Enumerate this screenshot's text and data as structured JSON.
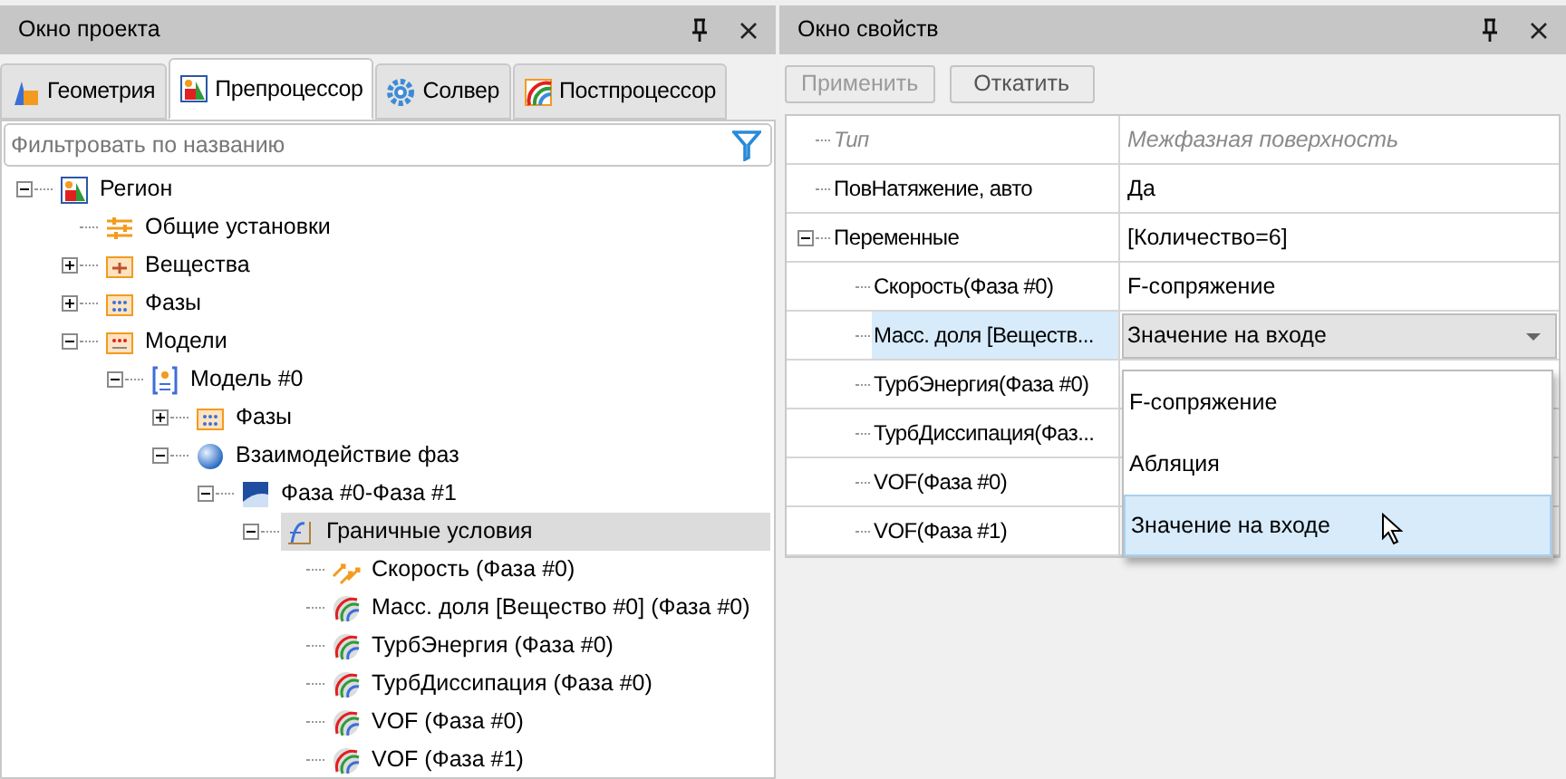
{
  "project_panel": {
    "title": "Окно проекта",
    "tabs": [
      {
        "label": "Геометрия",
        "kind": "geometry",
        "selected": false
      },
      {
        "label": "Препроцессор",
        "kind": "region",
        "selected": true
      },
      {
        "label": "Солвер",
        "kind": "gear",
        "selected": false
      },
      {
        "label": "Постпроцессор",
        "kind": "rainbow",
        "selected": false
      }
    ],
    "filter": {
      "placeholder": "Фильтровать по названию"
    },
    "tree": [
      {
        "label": "Регион",
        "kind": "region",
        "expanded": true,
        "selected": false,
        "children": [
          {
            "label": "Общие установки",
            "kind": "sliders",
            "selected": false
          },
          {
            "label": "Вещества",
            "kind": "substances",
            "expanded": false,
            "selected": false
          },
          {
            "label": "Фазы",
            "kind": "phases",
            "expanded": false,
            "selected": false
          },
          {
            "label": "Модели",
            "kind": "models",
            "expanded": true,
            "selected": false,
            "children": [
              {
                "label": "Модель #0",
                "kind": "model",
                "expanded": true,
                "selected": false,
                "children": [
                  {
                    "label": "Фазы",
                    "kind": "phases",
                    "expanded": false,
                    "selected": false
                  },
                  {
                    "label": "Взаимодействие фаз",
                    "kind": "sphere",
                    "expanded": true,
                    "selected": false,
                    "children": [
                      {
                        "label": "Фаза #0-Фаза #1",
                        "kind": "interface",
                        "expanded": true,
                        "selected": false,
                        "children": [
                          {
                            "label": "Граничные условия",
                            "kind": "bc",
                            "expanded": true,
                            "selected": true,
                            "children": [
                              {
                                "label": "Скорость (Фаза #0)",
                                "kind": "velocity",
                                "selected": false
                              },
                              {
                                "label": "Масс. доля [Вещество #0] (Фаза #0)",
                                "kind": "field",
                                "selected": false
                              },
                              {
                                "label": "ТурбЭнергия (Фаза #0)",
                                "kind": "field",
                                "selected": false
                              },
                              {
                                "label": "ТурбДиссипация (Фаза #0)",
                                "kind": "field",
                                "selected": false
                              },
                              {
                                "label": "VOF (Фаза #0)",
                                "kind": "field",
                                "selected": false
                              },
                              {
                                "label": "VOF (Фаза #1)",
                                "kind": "field",
                                "selected": false
                              }
                            ]
                          }
                        ]
                      }
                    ]
                  }
                ]
              }
            ]
          }
        ]
      }
    ]
  },
  "properties_panel": {
    "title": "Окно свойств",
    "buttons": [
      {
        "label": "Применить",
        "disabled": true
      },
      {
        "label": "Откатить",
        "disabled": false
      }
    ],
    "rows": [
      {
        "name": "Тип",
        "value": "Межфазная поверхность",
        "kind": "readonly",
        "selected": false
      },
      {
        "name": "ПовНатяжение, авто",
        "value": "Да",
        "kind": "plain",
        "selected": false
      },
      {
        "name": "Переменные",
        "value": "[Количество=6]",
        "kind": "group",
        "expanded": true,
        "selected": false,
        "children": [
          {
            "name": "Скорость(Фаза #0)",
            "value": "F-сопряжение",
            "kind": "plain",
            "selected": false
          },
          {
            "name": "Масс. доля [Веществ...",
            "value": "Значение на входе",
            "kind": "combo",
            "selected": true
          },
          {
            "name": "ТурбЭнергия(Фаза #0)",
            "kind": "plain",
            "selected": false
          },
          {
            "name": "ТурбДиссипация(Фаз...",
            "kind": "plain",
            "selected": false
          },
          {
            "name": "VOF(Фаза #0)",
            "kind": "plain",
            "selected": false
          },
          {
            "name": "VOF(Фаза #1)",
            "kind": "plain",
            "selected": false
          }
        ]
      }
    ],
    "dropdown_options": [
      {
        "label": "F-сопряжение",
        "selected": false
      },
      {
        "label": "Абляция",
        "selected": false
      },
      {
        "label": "Значение на входе",
        "selected": true
      }
    ]
  }
}
